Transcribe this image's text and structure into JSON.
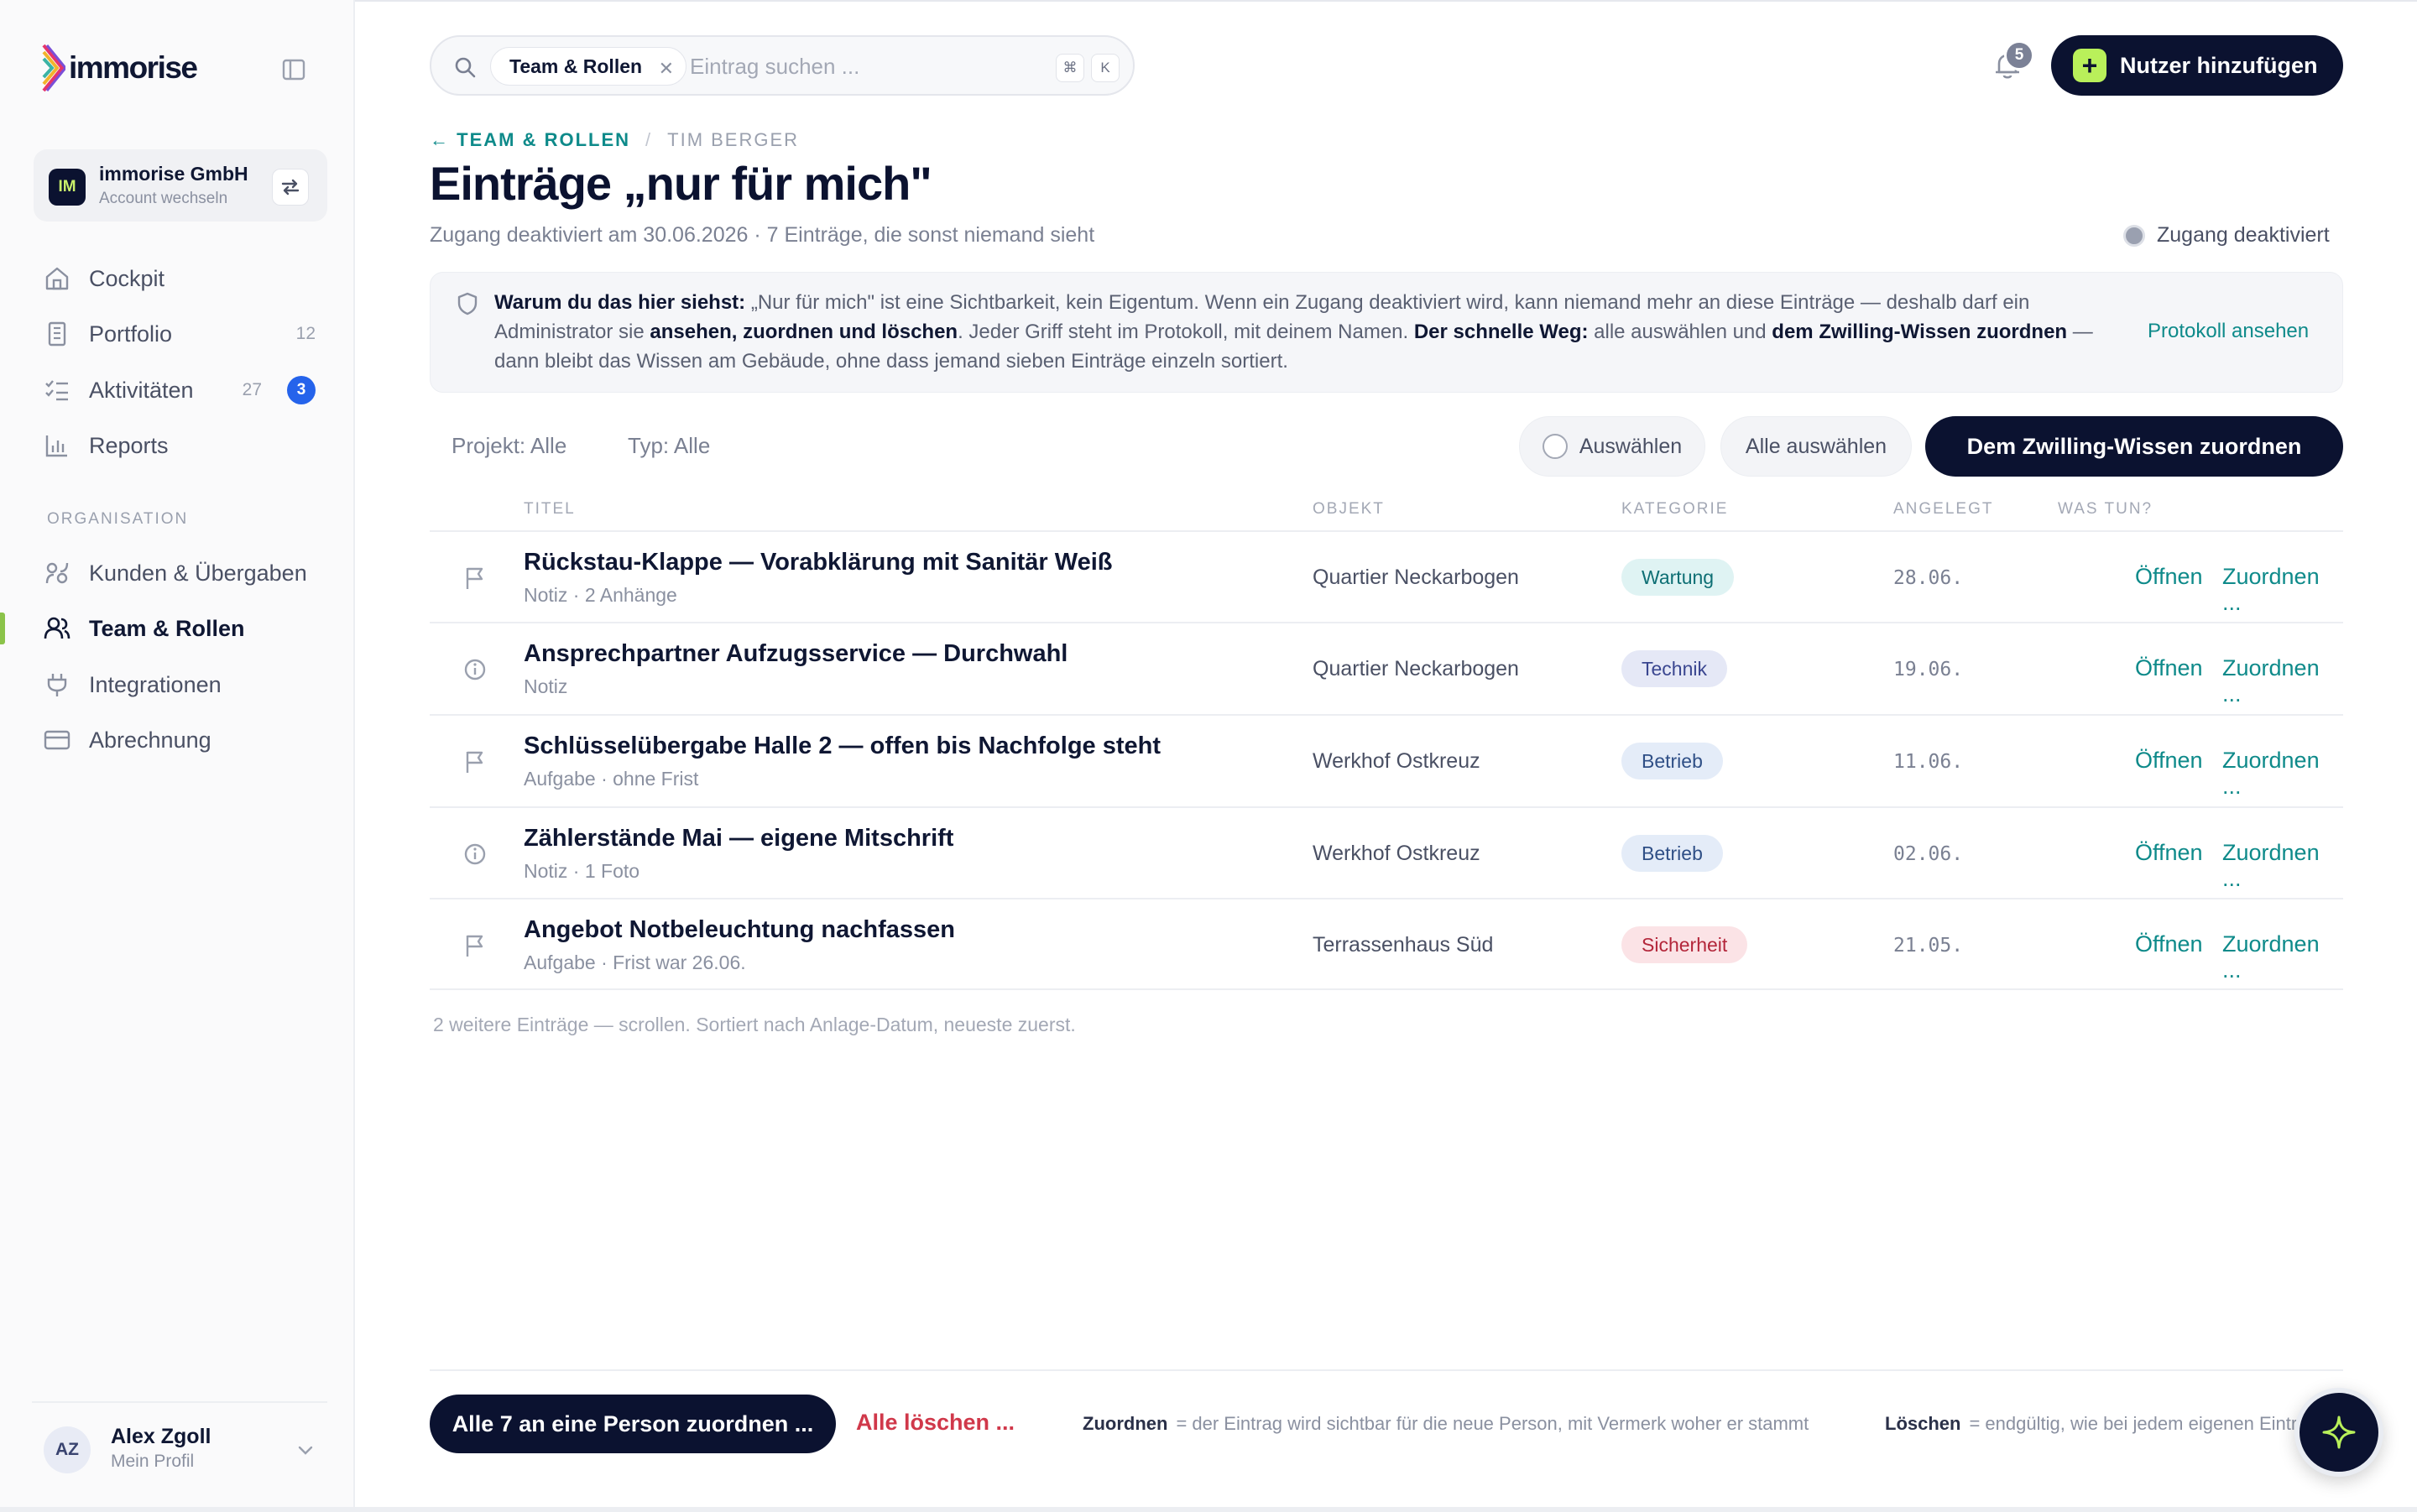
{
  "brand": {
    "name": "immorise"
  },
  "account": {
    "initials": "IM",
    "name": "immorise GmbH",
    "sub": "Account wechseln"
  },
  "nav": {
    "main": [
      {
        "label": "Cockpit"
      },
      {
        "label": "Portfolio",
        "count": "12"
      },
      {
        "label": "Aktivitäten",
        "count": "27",
        "badge": "3"
      },
      {
        "label": "Reports"
      }
    ],
    "section_label": "ORGANISATION",
    "org": [
      {
        "label": "Kunden & Übergaben"
      },
      {
        "label": "Team & Rollen",
        "active": true
      },
      {
        "label": "Integrationen"
      },
      {
        "label": "Abrechnung"
      }
    ]
  },
  "profile": {
    "initials": "AZ",
    "name": "Alex Zgoll",
    "sub": "Mein Profil"
  },
  "search": {
    "chip": "Team & Rollen",
    "placeholder": "Eintrag suchen ...",
    "kbd1": "⌘",
    "kbd2": "K"
  },
  "notifications": {
    "count": "5"
  },
  "add_user": {
    "label": "Nutzer hinzufügen"
  },
  "breadcrumb": {
    "back": "TEAM & ROLLEN",
    "sep": "/",
    "current": "TIM BERGER"
  },
  "page": {
    "title": "Einträge „nur für mich\"",
    "subtitle": "Zugang deaktiviert am 30.06.2026 · 7 Einträge, die sonst niemand sieht",
    "status": "Zugang deaktiviert"
  },
  "info": {
    "lead": "Warum du das hier siehst:",
    "t1": " „Nur für mich\" ist eine Sichtbarkeit, kein Eigentum. Wenn ein Zugang deaktiviert wird, kann niemand mehr an diese Einträge — deshalb darf ein Administrator sie ",
    "b1": "ansehen, zuordnen und löschen",
    "t2": ". Jeder Griff steht im Protokoll, mit deinem Namen. ",
    "b2": "Der schnelle Weg:",
    "t3": " alle auswählen und ",
    "b3": "dem Zwilling-Wissen zuordnen",
    "t4": " — dann bleibt das Wissen am Gebäude, ohne dass jemand sieben Einträge einzeln sortiert.",
    "link": "Protokoll ansehen"
  },
  "filters": {
    "project": "Projekt: Alle",
    "type": "Typ: Alle"
  },
  "actions": {
    "select": "Auswählen",
    "select_all": "Alle auswählen",
    "assign_twin": "Dem Zwilling-Wissen zuordnen"
  },
  "table": {
    "headers": {
      "title": "TITEL",
      "object": "OBJEKT",
      "category": "KATEGORIE",
      "created": "ANGELEGT",
      "todo": "WAS TUN?"
    },
    "rows": [
      {
        "icon": "flag-icon",
        "title": "Rückstau-Klappe — Vorabklärung mit Sanitär Weiß",
        "sub": "Notiz · 2 Anhänge",
        "object": "Quartier Neckarbogen",
        "category": "Wartung",
        "date": "28.06.",
        "open": "Öffnen",
        "assign": "Zuordnen ..."
      },
      {
        "icon": "info-icon",
        "title": "Ansprechpartner Aufzugsservice — Durchwahl",
        "sub": "Notiz",
        "object": "Quartier Neckarbogen",
        "category": "Technik",
        "date": "19.06.",
        "open": "Öffnen",
        "assign": "Zuordnen ..."
      },
      {
        "icon": "flag-icon",
        "title": "Schlüsselübergabe Halle 2 — offen bis Nachfolge steht",
        "sub": "Aufgabe · ohne Frist",
        "object": "Werkhof Ostkreuz",
        "category": "Betrieb",
        "date": "11.06.",
        "open": "Öffnen",
        "assign": "Zuordnen ..."
      },
      {
        "icon": "info-icon",
        "title": "Zählerstände Mai — eigene Mitschrift",
        "sub": "Notiz · 1 Foto",
        "object": "Werkhof Ostkreuz",
        "category": "Betrieb",
        "date": "02.06.",
        "open": "Öffnen",
        "assign": "Zuordnen ..."
      },
      {
        "icon": "flag-icon",
        "title": "Angebot Notbeleuchtung nachfassen",
        "sub": "Aufgabe · Frist war 26.06.",
        "object": "Terrassenhaus Süd",
        "category": "Sicherheit",
        "date": "21.05.",
        "open": "Öffnen",
        "assign": "Zuordnen ..."
      }
    ],
    "footnote": "2 weitere Einträge — scrollen. Sortiert nach Anlage-Datum, neueste zuerst."
  },
  "colors": {
    "Wartung": {
      "bg": "#dff3f3",
      "fg": "#0e6f74"
    },
    "Technik": {
      "bg": "#e5e8f6",
      "fg": "#3a4690"
    },
    "Betrieb": {
      "bg": "#e4ecf8",
      "fg": "#2f4f86"
    },
    "Sicherheit": {
      "bg": "#fbe3e6",
      "fg": "#b3263a"
    }
  },
  "bottom": {
    "assign_all": "Alle 7 an eine Person zuordnen ...",
    "delete_all": "Alle löschen ...",
    "legend_assign_term": "Zuordnen",
    "legend_assign_text": "= der Eintrag wird sichtbar für die neue Person, mit Vermerk woher er stammt",
    "legend_delete_term": "Löschen",
    "legend_delete_text": "= endgültig, wie bei jedem eigenen Eintrag"
  }
}
